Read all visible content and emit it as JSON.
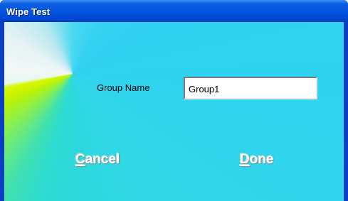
{
  "window": {
    "title": "Wipe Test"
  },
  "form": {
    "group_name_label": "Group Name",
    "group_name_value": "Group1"
  },
  "buttons": {
    "cancel": {
      "mnemonic": "C",
      "rest": "ancel"
    },
    "done": {
      "mnemonic": "D",
      "rest": "one"
    }
  },
  "colors": {
    "titlebar": "#0454e0",
    "client_primary": "#30d0f0",
    "client_accent": "#cdf400",
    "button_text": "#ffffff"
  }
}
